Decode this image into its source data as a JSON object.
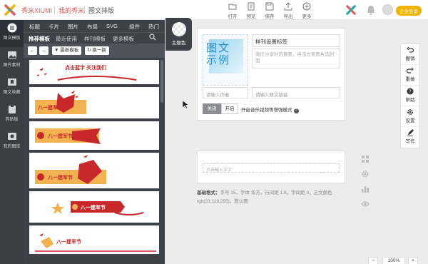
{
  "header": {
    "brand": "秀米XIUMI",
    "my_xiumi": "我的秀米",
    "page_name": "图文排版",
    "actions": [
      {
        "label": "打开",
        "icon": "folder-icon"
      },
      {
        "label": "预览",
        "icon": "preview-icon"
      },
      {
        "label": "保存",
        "icon": "save-icon"
      },
      {
        "label": "导出",
        "icon": "export-icon"
      },
      {
        "label": "更多",
        "icon": "more-icon"
      }
    ],
    "vip_badge": "企业会员"
  },
  "left_nav": [
    {
      "label": "图文模板",
      "icon": "template-icon",
      "active": true
    },
    {
      "label": "图片素材",
      "icon": "image-icon"
    },
    {
      "label": "图文收藏",
      "icon": "bookmark-icon"
    },
    {
      "label": "剪贴板",
      "icon": "clipboard-icon"
    },
    {
      "label": "我的图库",
      "icon": "gallery-icon"
    }
  ],
  "panel": {
    "categories": [
      "标题",
      "卡片",
      "图片",
      "布局",
      "SVG",
      "组件",
      "热门"
    ],
    "subtabs": [
      "推荐模板",
      "最近使用",
      "样刊模板",
      "更多模板"
    ],
    "newest_label": "最新模板",
    "refresh_label": "换一换",
    "cards": [
      {
        "text": "点击蓝字 关注我们"
      },
      {
        "text": "八一建军节"
      },
      {
        "text": "八一建军节"
      },
      {
        "text": "八一建军节"
      },
      {
        "text": "八一建军节"
      },
      {
        "text": "八一建军节"
      }
    ]
  },
  "theme": {
    "label": "主题色"
  },
  "doc": {
    "cover_text": "图文示例",
    "title": "样刊设置标签",
    "summary_placeholder": "微信分享时的摘要，点击左侧图片选封面",
    "author_placeholder": "请输入作者",
    "link_placeholder": "请输入原文链接",
    "toggle_off": "关闭",
    "toggle_on": "开启",
    "music_label": "开启音乐视频等增强模式"
  },
  "text_block": {
    "placeholder": "点击输入文字"
  },
  "format": {
    "label": "基础格式：",
    "detail": "字号 15，字体 华方，行间距 1.6，字间距 0，正文颜色 rgb(23,119,255)，默认图"
  },
  "right_toolbar": [
    {
      "label": "撤销",
      "icon": "undo-icon"
    },
    {
      "label": "重做",
      "icon": "redo-icon"
    },
    {
      "label": "帮助",
      "icon": "help-icon"
    },
    {
      "label": "设置",
      "icon": "settings-icon"
    },
    {
      "label": "写作",
      "icon": "write-icon"
    }
  ],
  "zoom": {
    "value": "100%"
  },
  "colors": {
    "brand": "#e55a5a",
    "panel_bg": "#3e4148",
    "nav_bg": "#3b3e45",
    "festival_red": "#c8282a",
    "festival_gold": "#f2b252",
    "vip": "#f0b400"
  }
}
